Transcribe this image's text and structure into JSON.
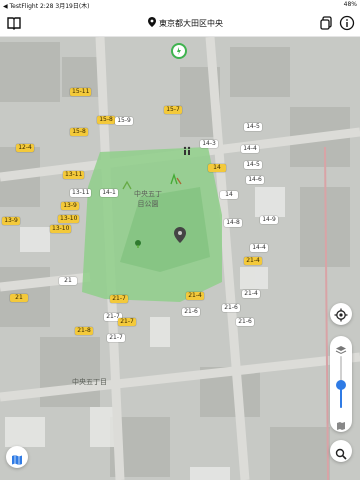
{
  "status_bar": {
    "left_text": "◀ TestFlight  2:28  3月19日(木)",
    "right_text": "48%"
  },
  "top_bar": {
    "location_label": "東京都大田区中央",
    "icons": [
      "book-icon",
      "location-pin-icon",
      "copy-icon",
      "info-icon"
    ]
  },
  "map": {
    "park_name_line1": "中央五丁",
    "park_name_line2": "目公園",
    "area_label": "中央五丁目",
    "colors": {
      "park": "#8fcf8a",
      "yellow_pin": "#f3c93b",
      "white_pin": "#ffffff",
      "accent_green": "#3fb34f"
    },
    "pins": [
      {
        "label": "15-11",
        "style": "yellow"
      },
      {
        "label": "15-7",
        "style": "yellow"
      },
      {
        "label": "15-8",
        "style": "yellow"
      },
      {
        "label": "15-8",
        "style": "yellow"
      },
      {
        "label": "15-9",
        "style": "white"
      },
      {
        "label": "12-4",
        "style": "yellow"
      },
      {
        "label": "14-5",
        "style": "white"
      },
      {
        "label": "14-3",
        "style": "white"
      },
      {
        "label": "14-4",
        "style": "white"
      },
      {
        "label": "14-5",
        "style": "white"
      },
      {
        "label": "14",
        "style": "yellow"
      },
      {
        "label": "14-6",
        "style": "white"
      },
      {
        "label": "13-11",
        "style": "yellow"
      },
      {
        "label": "13-11",
        "style": "white"
      },
      {
        "label": "14-1",
        "style": "white"
      },
      {
        "label": "14",
        "style": "white"
      },
      {
        "label": "13-9",
        "style": "yellow"
      },
      {
        "label": "13-9",
        "style": "yellow"
      },
      {
        "label": "13-10",
        "style": "yellow"
      },
      {
        "label": "13-10",
        "style": "yellow"
      },
      {
        "label": "14-9",
        "style": "white"
      },
      {
        "label": "14-8",
        "style": "white"
      },
      {
        "label": "14-4",
        "style": "white"
      },
      {
        "label": "21-4",
        "style": "yellow"
      },
      {
        "label": "21",
        "style": "white"
      },
      {
        "label": "21",
        "style": "yellow"
      },
      {
        "label": "21-7",
        "style": "yellow"
      },
      {
        "label": "21-4",
        "style": "yellow"
      },
      {
        "label": "21-4",
        "style": "white"
      },
      {
        "label": "21-7",
        "style": "white"
      },
      {
        "label": "21-6",
        "style": "white"
      },
      {
        "label": "21-6",
        "style": "white"
      },
      {
        "label": "21-7",
        "style": "yellow"
      },
      {
        "label": "21-8",
        "style": "yellow"
      },
      {
        "label": "21-6",
        "style": "white"
      },
      {
        "label": "21-7",
        "style": "white"
      }
    ]
  },
  "controls": {
    "layers_button": "map-layers",
    "locate_button": "current-location",
    "zoom_level": 0.45,
    "search_button": "search"
  }
}
